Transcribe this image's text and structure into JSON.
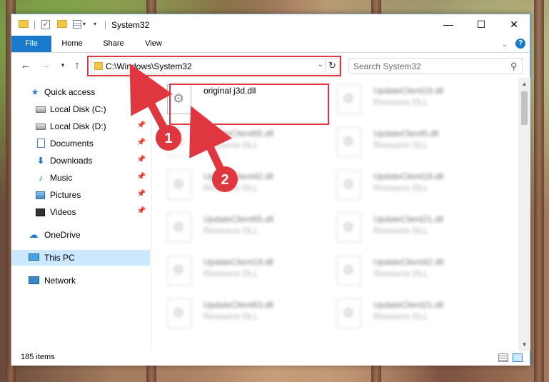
{
  "window": {
    "title": "System32",
    "minimize_glyph": "—",
    "maximize_glyph": "☐",
    "close_glyph": "✕"
  },
  "ribbon": {
    "tabs": [
      {
        "label": "File"
      },
      {
        "label": "Home"
      },
      {
        "label": "Share"
      },
      {
        "label": "View"
      }
    ]
  },
  "address": {
    "path": "C:\\Windows\\System32",
    "search_placeholder": "Search System32"
  },
  "nav": {
    "quick_access": "Quick access",
    "items": [
      {
        "label": "Local Disk (C:)",
        "icon": "drive-icon"
      },
      {
        "label": "Local Disk (D:)",
        "icon": "drive-icon"
      },
      {
        "label": "Documents",
        "icon": "documents-icon"
      },
      {
        "label": "Downloads",
        "icon": "downloads-icon"
      },
      {
        "label": "Music",
        "icon": "music-icon"
      },
      {
        "label": "Pictures",
        "icon": "pictures-icon"
      },
      {
        "label": "Videos",
        "icon": "videos-icon"
      }
    ],
    "onedrive": "OneDrive",
    "this_pc": "This PC",
    "network": "Network"
  },
  "files": {
    "highlighted": {
      "name": "original j3d.dll"
    },
    "left_column": [
      {
        "name": "UpdateClient65.dll",
        "type": "Resource DLL"
      },
      {
        "name": "UpdateClient42.dll",
        "type": "Resource DLL"
      },
      {
        "name": "UpdateClient65.dll",
        "type": "Resource DLL"
      },
      {
        "name": "UpdateClient19.dll",
        "type": "Resource DLL"
      },
      {
        "name": "UpdateClient63.dll",
        "type": "Resource DLL"
      }
    ],
    "right_column": [
      {
        "name": "UpdateClient19.dll",
        "type": "Resource DLL"
      },
      {
        "name": "UpdateClient5.dll",
        "type": "Resource DLL"
      },
      {
        "name": "UpdateClient19.dll",
        "type": "Resource DLL"
      },
      {
        "name": "UpdateClient21.dll",
        "type": "Resource DLL"
      },
      {
        "name": "UpdateClient42.dll",
        "type": "Resource DLL"
      },
      {
        "name": "UpdateClient21.dll",
        "type": "Resource DLL"
      }
    ]
  },
  "status": {
    "item_count": "185 items"
  },
  "annotations": {
    "step1": "1",
    "step2": "2",
    "color": "#e0363f"
  }
}
